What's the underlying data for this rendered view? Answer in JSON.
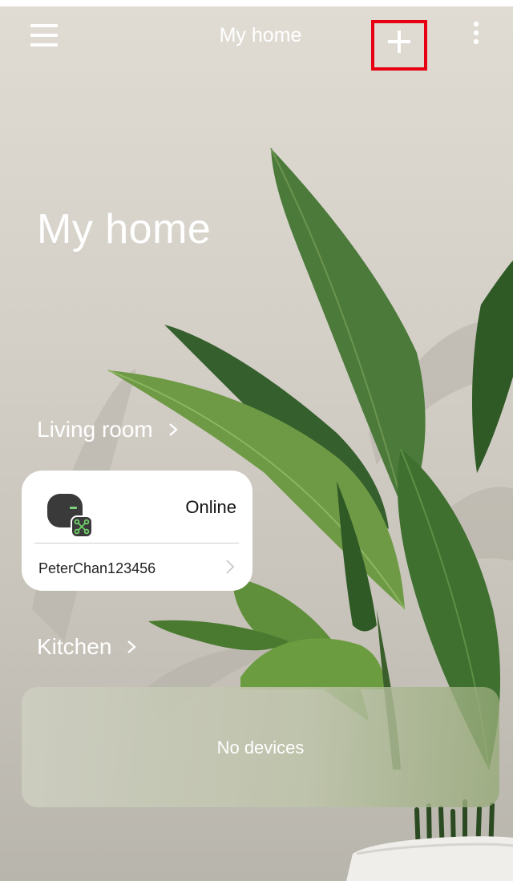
{
  "header": {
    "title": "My home",
    "menu_icon": "hamburger-menu-icon",
    "add_icon": "plus-icon",
    "more_icon": "vertical-ellipsis-icon",
    "highlight_color": "#e60012"
  },
  "home": {
    "title": "My home"
  },
  "rooms": [
    {
      "name": "Living room",
      "devices": [
        {
          "status": "Online",
          "name": "PeterChan123456",
          "icon": "smart-device-icon"
        }
      ]
    },
    {
      "name": "Kitchen",
      "empty_text": "No devices"
    }
  ],
  "colors": {
    "card_bg": "#ffffff",
    "text_light": "#ffffff",
    "device_icon_green": "#3aa64b"
  }
}
